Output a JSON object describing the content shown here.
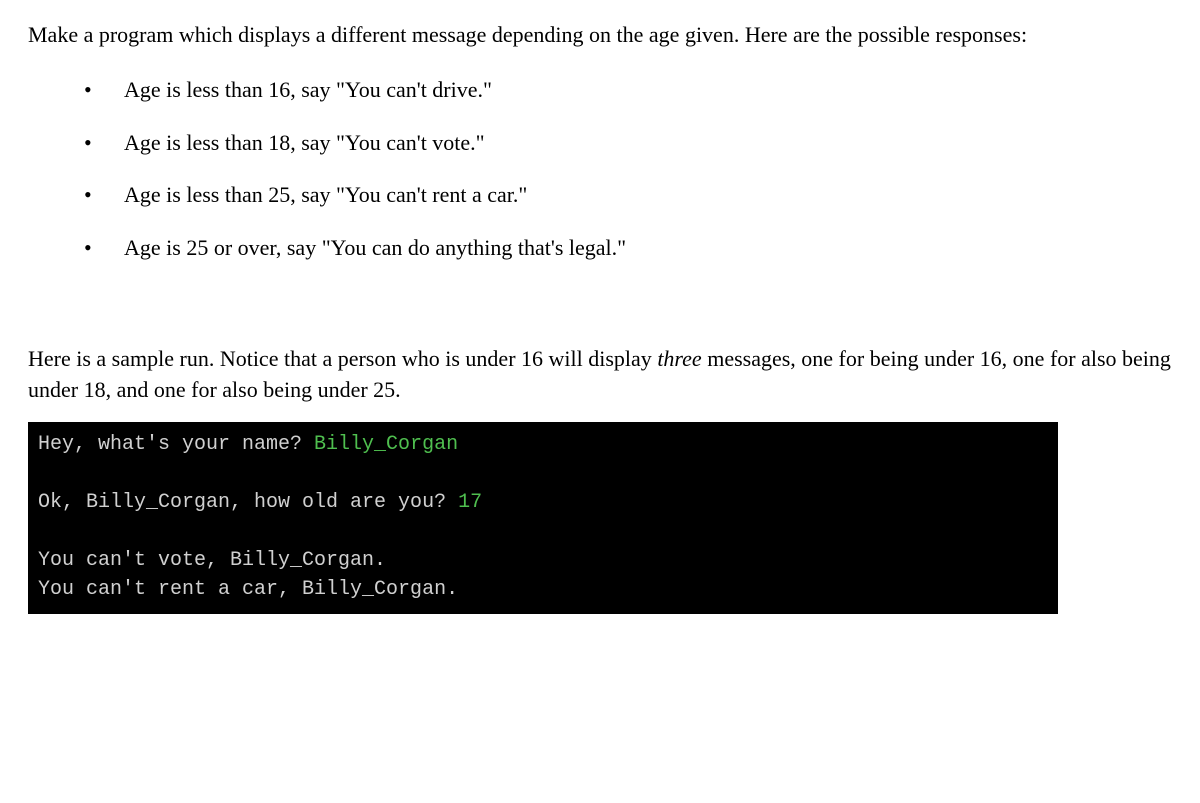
{
  "intro": "Make a program which displays a different message depending on the age given. Here are the possible responses:",
  "rules": [
    "Age is less than 16, say \"You can't drive.\"",
    "Age is less than 18, say \"You can't vote.\"",
    "Age is less than 25, say \"You can't rent a car.\"",
    "Age is 25 or over, say \"You can do anything that's legal.\""
  ],
  "sample_note_pre": "Here is a sample run. Notice that a person who is under 16 will display ",
  "sample_note_italic": "three",
  "sample_note_post": " messages, one for being under 16, one for also being under 18, and one for also being under 25.",
  "terminal": {
    "line1_prompt": "Hey, what's your name? ",
    "line1_input": "Billy_Corgan",
    "line2_prompt": "Ok, Billy_Corgan, how old are you? ",
    "line2_input": "17",
    "line3": "You can't vote, Billy_Corgan.",
    "line4": "You can't rent a car, Billy_Corgan."
  }
}
